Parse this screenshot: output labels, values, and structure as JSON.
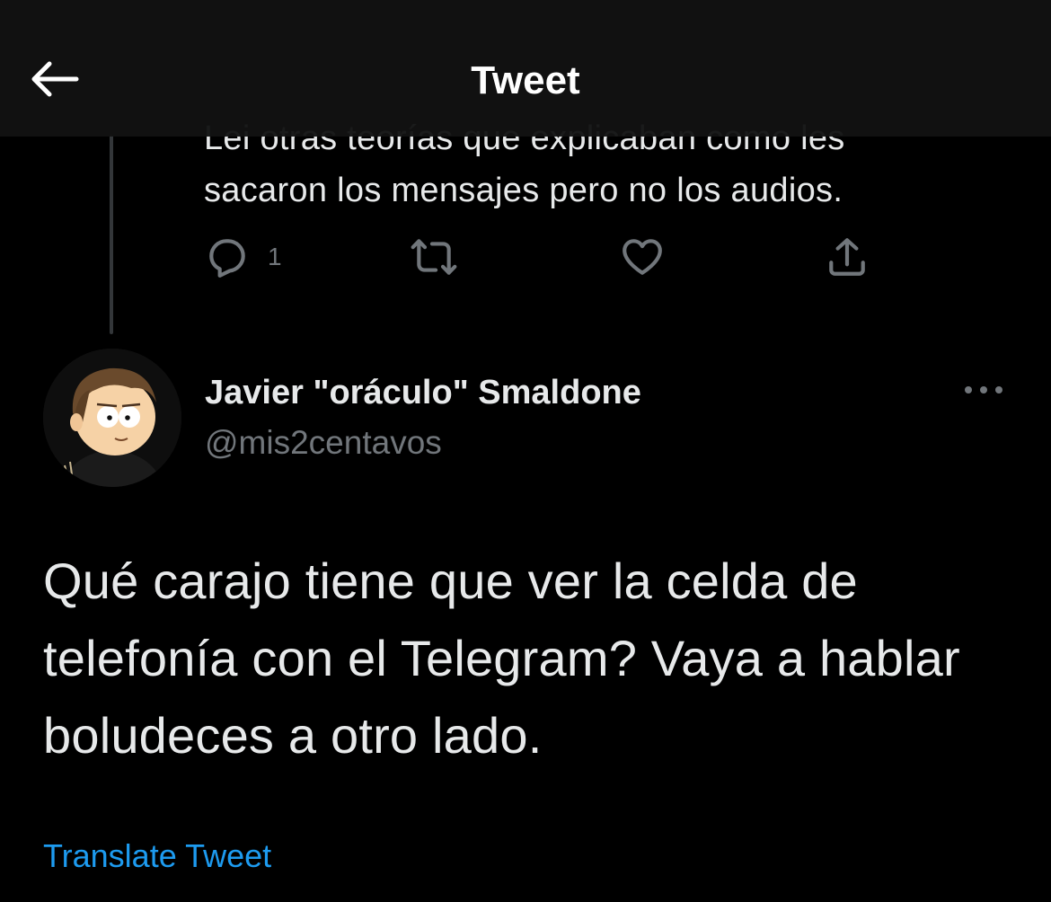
{
  "header": {
    "title": "Tweet",
    "back_icon": "arrow-left-icon"
  },
  "previous_tweet": {
    "text_cut_line": "Lei otras teorías que explicaban como les",
    "text_visible_line": "sacaron los mensajes pero no los audios.",
    "actions": {
      "reply_icon": "reply-icon",
      "reply_count": "1",
      "retweet_icon": "retweet-icon",
      "like_icon": "heart-icon",
      "share_icon": "share-icon"
    }
  },
  "tweet": {
    "author_name": "Javier \"oráculo\" Smaldone",
    "author_handle": "@mis2centavos",
    "more_icon": "more-options-icon",
    "body": "Qué carajo tiene que ver la celda de telefonía con el Telegram? Vaya a hablar boludeces a otro lado.",
    "translate_label": "Translate Tweet"
  },
  "colors": {
    "background": "#000000",
    "text_primary": "#e7e9ea",
    "text_secondary": "#71767b",
    "link": "#1d9bf0",
    "header_bg": "#121212"
  }
}
